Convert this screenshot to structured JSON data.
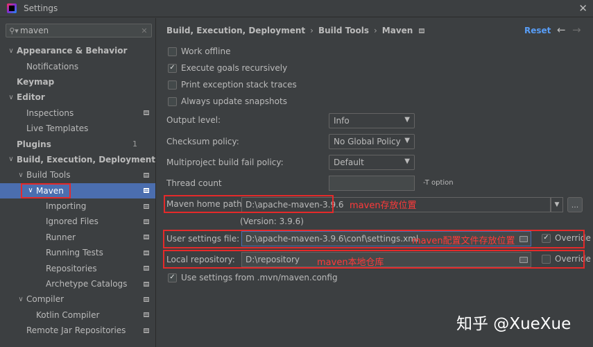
{
  "window": {
    "title": "Settings",
    "close_icon": "close-icon"
  },
  "search": {
    "value": "maven",
    "icon": "search-icon",
    "clear_icon": "clear-icon"
  },
  "tree": [
    {
      "label": "Appearance & Behavior",
      "level": 0,
      "arrow": "∨",
      "bold": true
    },
    {
      "label": "Notifications",
      "level": 1
    },
    {
      "label": "Keymap",
      "level": 0,
      "bold": true
    },
    {
      "label": "Editor",
      "level": 0,
      "arrow": "∨",
      "bold": true
    },
    {
      "label": "Inspections",
      "level": 1,
      "proj": true
    },
    {
      "label": "Live Templates",
      "level": 1
    },
    {
      "label": "Plugins",
      "level": 0,
      "bold": true,
      "count": "1"
    },
    {
      "label": "Build, Execution, Deployment",
      "level": 0,
      "arrow": "∨",
      "bold": true
    },
    {
      "label": "Build Tools",
      "level": 1,
      "arrow": "∨",
      "proj": true
    },
    {
      "label": "Maven",
      "level": 2,
      "arrow": "∨",
      "proj": true,
      "selected": true
    },
    {
      "label": "Importing",
      "level": 3,
      "proj": true
    },
    {
      "label": "Ignored Files",
      "level": 3,
      "proj": true
    },
    {
      "label": "Runner",
      "level": 3,
      "proj": true
    },
    {
      "label": "Running Tests",
      "level": 3,
      "proj": true
    },
    {
      "label": "Repositories",
      "level": 3,
      "proj": true
    },
    {
      "label": "Archetype Catalogs",
      "level": 3,
      "proj": true
    },
    {
      "label": "Compiler",
      "level": 1,
      "arrow": "∨",
      "proj": true
    },
    {
      "label": "Kotlin Compiler",
      "level": 2,
      "proj": true
    },
    {
      "label": "Remote Jar Repositories",
      "level": 1,
      "proj": true
    }
  ],
  "breadcrumb": {
    "items": [
      "Build, Execution, Deployment",
      "Build Tools",
      "Maven"
    ],
    "separator": "›"
  },
  "header": {
    "reset_label": "Reset",
    "back_icon": "←",
    "forward_icon": "→"
  },
  "checkboxes": [
    {
      "label": "Work offline",
      "checked": false
    },
    {
      "label": "Execute goals recursively",
      "checked": true
    },
    {
      "label": "Print exception stack traces",
      "checked": false
    },
    {
      "label": "Always update snapshots",
      "checked": false
    }
  ],
  "form": {
    "output_level": {
      "label": "Output level:",
      "value": "Info"
    },
    "checksum_policy": {
      "label": "Checksum policy:",
      "value": "No Global Policy"
    },
    "multiproject": {
      "label": "Multiproject build fail policy:",
      "value": "Default"
    },
    "thread_count": {
      "label": "Thread count",
      "value": "",
      "hint": "-T option"
    },
    "maven_home": {
      "label": "Maven home path:",
      "value": "D:\\apache-maven-3.9.6",
      "version": "(Version: 3.9.6)",
      "more_label": "..."
    },
    "user_settings": {
      "label": "User settings file:",
      "value": "D:\\apache-maven-3.9.6\\conf\\settings.xml",
      "override_label": "Override",
      "override_checked": true
    },
    "local_repo": {
      "label": "Local repository:",
      "value": "D:\\repository",
      "override_label": "Override",
      "override_checked": false
    },
    "mvn_config": {
      "label": "Use settings from .mvn/maven.config",
      "checked": true
    }
  },
  "annotations": {
    "maven_home": "maven存放位置",
    "user_settings": "maven配置文件存放位置",
    "local_repo": "maven本地仓库"
  },
  "watermark": "知乎 @XueXue",
  "colors": {
    "accent": "#4b6eaf",
    "link": "#589df6",
    "annotation": "#e52a2a"
  }
}
